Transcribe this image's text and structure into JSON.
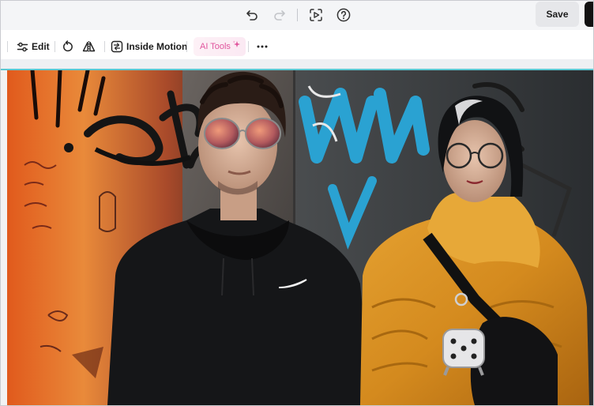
{
  "topbar": {
    "undo_icon": "undo-icon",
    "redo_icon": "redo-icon",
    "preview_icon": "preview-play-icon",
    "help_icon": "help-icon",
    "save_label": "Save"
  },
  "toolbar": {
    "edit_label": "Edit",
    "rotate_icon": "rotate-icon",
    "flip_icon": "flip-icon",
    "inside_motion_label": "Inside Motion",
    "ai_tools_label": "AI Tools",
    "more_icon": "more-icon"
  },
  "colors": {
    "accent_cyan": "#5cc8d2",
    "ai_pink": "#e0559d",
    "save_bg": "#e6e7ea"
  }
}
